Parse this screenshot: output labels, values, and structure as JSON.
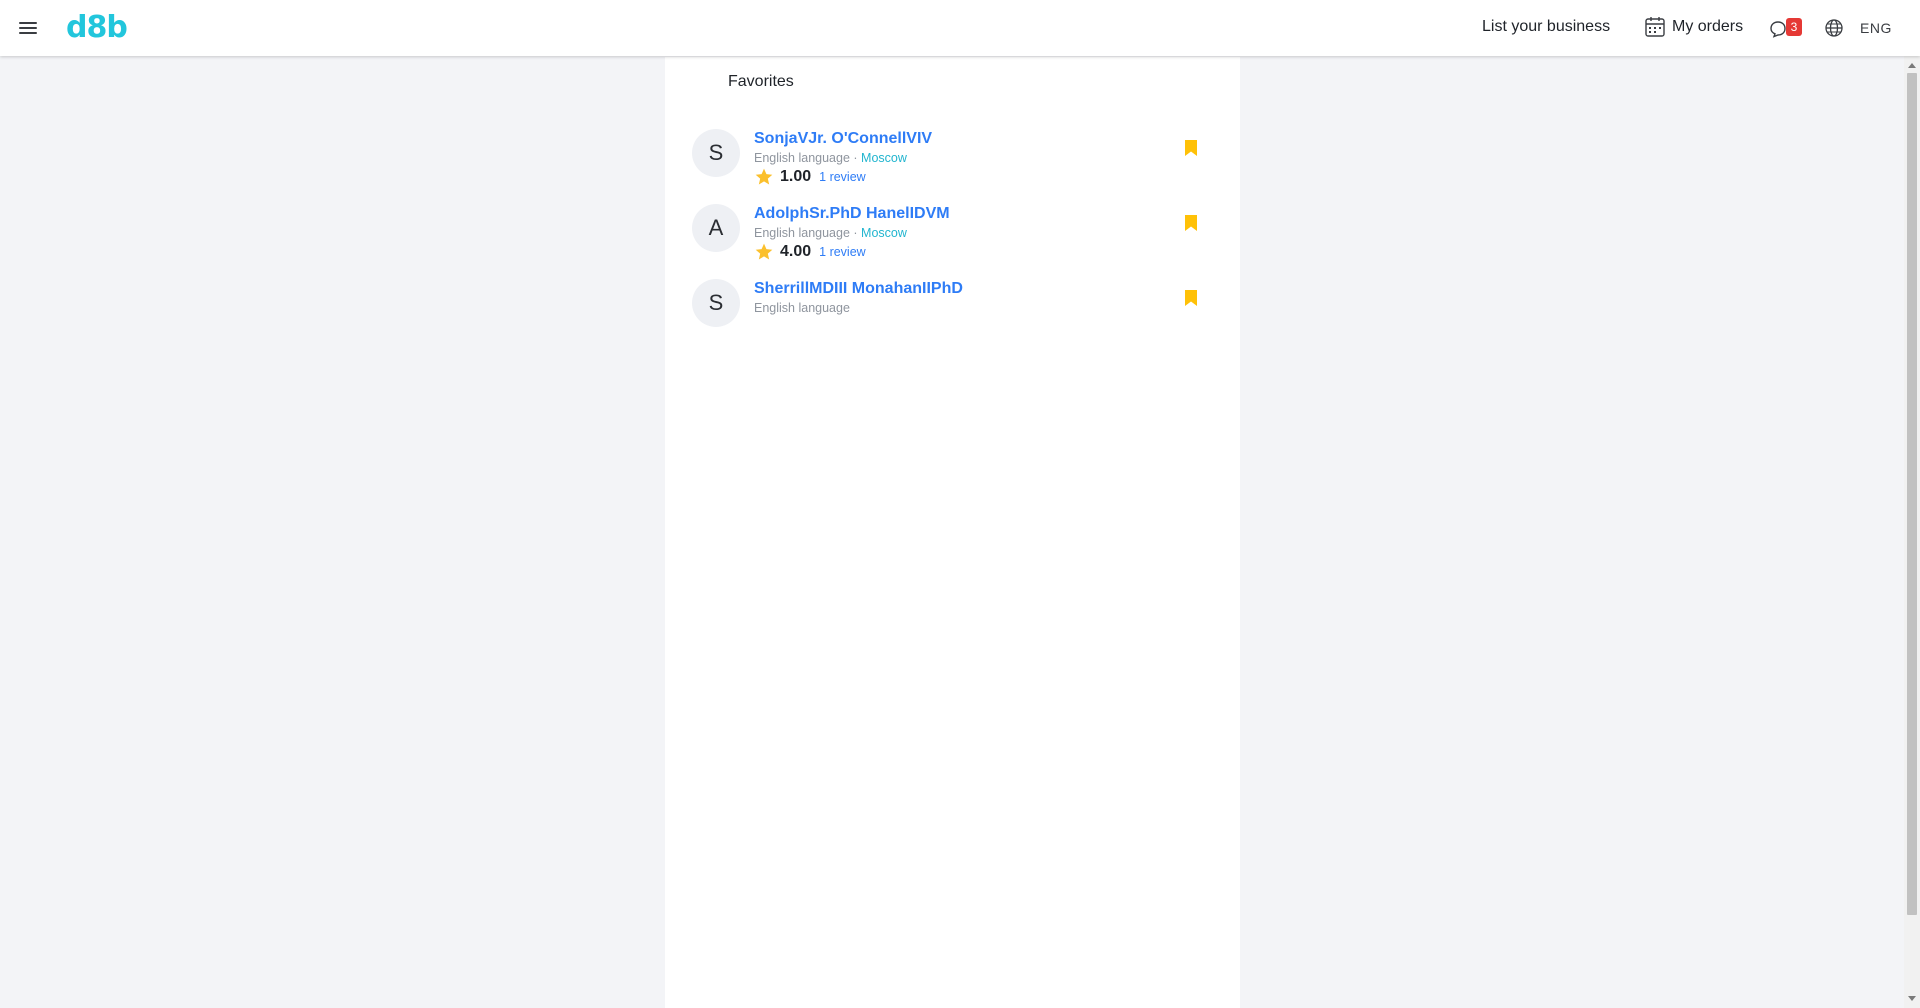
{
  "header": {
    "logo": "d8b",
    "list_business": "List your business",
    "my_orders": "My orders",
    "chat_badge": "3",
    "language": "ENG"
  },
  "favorites": {
    "title": "Favorites",
    "items": [
      {
        "initial": "S",
        "name": "SonjaVJr. O'ConnellVIV",
        "language": "English language",
        "separator": " · ",
        "city": "Moscow",
        "rating": "1.00",
        "reviews": "1 review"
      },
      {
        "initial": "A",
        "name": "AdolphSr.PhD HanelIDVM",
        "language": "English language",
        "separator": " · ",
        "city": "Moscow",
        "rating": "4.00",
        "reviews": "1 review"
      },
      {
        "initial": "S",
        "name": "SherrillMDIII MonahanIIPhD",
        "language": "English language"
      }
    ]
  },
  "colors": {
    "brand": "#22c6dc",
    "link": "#2e7cf6",
    "bookmark": "#ffc107",
    "star": "#fbc02d",
    "badge": "#e53935"
  },
  "icons": [
    "menu-icon",
    "calendar-icon",
    "chat-icon",
    "globe-icon",
    "star-icon",
    "bookmark-icon"
  ]
}
